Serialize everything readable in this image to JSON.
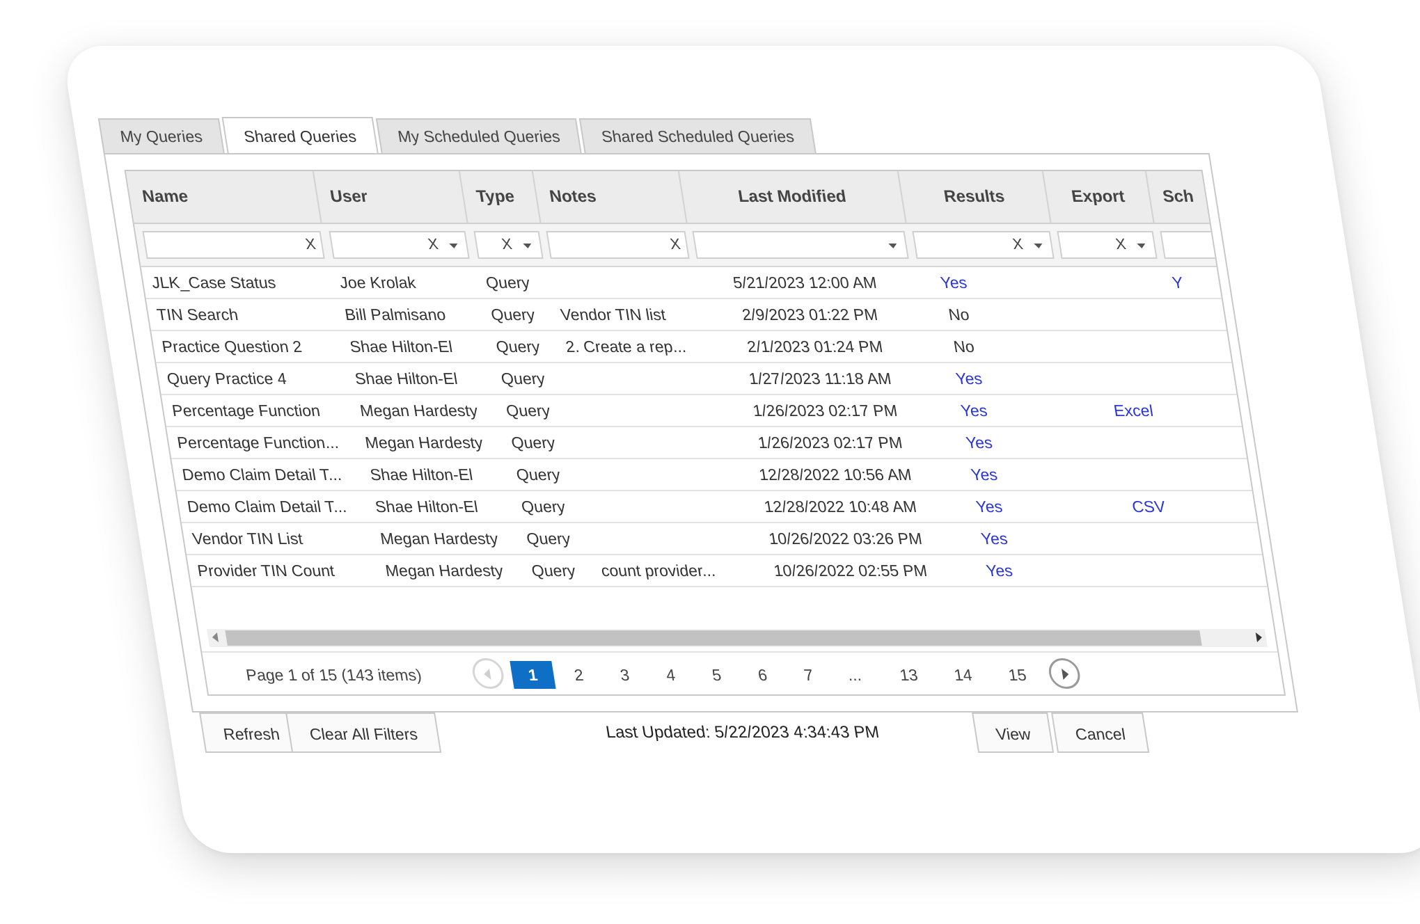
{
  "tabs": [
    {
      "label": "My Queries",
      "active": false
    },
    {
      "label": "Shared Queries",
      "active": true
    },
    {
      "label": "My Scheduled Queries",
      "active": false
    },
    {
      "label": "Shared Scheduled Queries",
      "active": false
    }
  ],
  "grid": {
    "columns": [
      "Name",
      "User",
      "Type",
      "Notes",
      "Last Modified",
      "Results",
      "Export",
      "Sch"
    ],
    "filters": {
      "clear_glyph": "X"
    },
    "rows": [
      {
        "name": "JLK_Case Status",
        "user": "Joe Krolak",
        "type": "Query",
        "notes": "",
        "modified": "5/21/2023 12:00 AM",
        "results": "Yes",
        "export": "",
        "sched": "Y"
      },
      {
        "name": "TIN Search",
        "user": "Bill Palmisano",
        "type": "Query",
        "notes": "Vendor TIN list",
        "modified": "2/9/2023 01:22 PM",
        "results": "No",
        "export": "",
        "sched": ""
      },
      {
        "name": "Practice Question 2",
        "user": "Shae Hilton-El",
        "type": "Query",
        "notes": "2. Create a rep...",
        "modified": "2/1/2023 01:24 PM",
        "results": "No",
        "export": "",
        "sched": ""
      },
      {
        "name": "Query Practice 4",
        "user": "Shae Hilton-El",
        "type": "Query",
        "notes": "",
        "modified": "1/27/2023 11:18 AM",
        "results": "Yes",
        "export": "",
        "sched": ""
      },
      {
        "name": "Percentage Function",
        "user": "Megan Hardesty",
        "type": "Query",
        "notes": "",
        "modified": "1/26/2023 02:17 PM",
        "results": "Yes",
        "export": "Excel",
        "sched": ""
      },
      {
        "name": "Percentage Function...",
        "user": "Megan Hardesty",
        "type": "Query",
        "notes": "",
        "modified": "1/26/2023 02:17 PM",
        "results": "Yes",
        "export": "",
        "sched": ""
      },
      {
        "name": "Demo Claim Detail T...",
        "user": "Shae Hilton-El",
        "type": "Query",
        "notes": "",
        "modified": "12/28/2022 10:56 AM",
        "results": "Yes",
        "export": "",
        "sched": ""
      },
      {
        "name": "Demo Claim Detail T...",
        "user": "Shae Hilton-El",
        "type": "Query",
        "notes": "",
        "modified": "12/28/2022 10:48 AM",
        "results": "Yes",
        "export": "CSV",
        "sched": ""
      },
      {
        "name": "Vendor TIN List",
        "user": "Megan Hardesty",
        "type": "Query",
        "notes": "",
        "modified": "10/26/2022 03:26 PM",
        "results": "Yes",
        "export": "",
        "sched": ""
      },
      {
        "name": "Provider TIN Count",
        "user": "Megan Hardesty",
        "type": "Query",
        "notes": "count provider...",
        "modified": "10/26/2022 02:55 PM",
        "results": "Yes",
        "export": "",
        "sched": ""
      }
    ]
  },
  "pager": {
    "info": "Page 1 of 15 (143 items)",
    "pages": [
      "1",
      "2",
      "3",
      "4",
      "5",
      "6",
      "7",
      "...",
      "13",
      "14",
      "15"
    ],
    "current": "1"
  },
  "footer": {
    "refresh_label": "Refresh",
    "clear_filters_label": "Clear All Filters",
    "last_updated": "Last Updated: 5/22/2023 4:34:43 PM",
    "view_label": "View",
    "cancel_label": "Cancel"
  },
  "colors": {
    "link": "#2a35d6",
    "active_page": "#0f6fc6"
  }
}
